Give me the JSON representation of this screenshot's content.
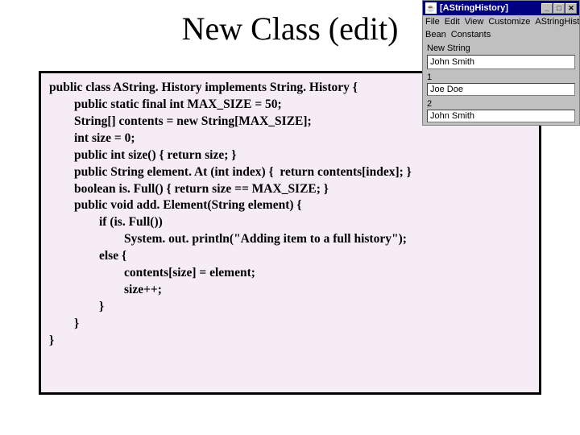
{
  "slide": {
    "title": "New Class (edit)"
  },
  "code": {
    "line1": "public class AString. History implements String. History {",
    "line2": "        public static final int MAX_SIZE = 50;",
    "line3": "        String[] contents = new String[MAX_SIZE];",
    "line4": "        int size = 0;",
    "line5": "        public int size() { return size; }",
    "line6": "        public String element. At (int index) {  return contents[index]; }",
    "line7": "        boolean is. Full() { return size == MAX_SIZE; }",
    "line8": "        public void add. Element(String element) {",
    "line9": "                if (is. Full())",
    "line10": "                        System. out. println(\"Adding item to a full history\");",
    "line11": "                else {",
    "line12": "                        contents[size] = element;",
    "line13": "                        size++;",
    "line14": "                }",
    "line15": "        }",
    "line16": "}"
  },
  "window": {
    "title": "[AStringHistory]",
    "minimize": "_",
    "maximize": "□",
    "close": "✕",
    "menus": {
      "file": "File",
      "edit": "Edit",
      "view": "View",
      "customize": "Customize",
      "ahistory": "AStringHistory"
    },
    "bean": "Bean",
    "constants": "Constants",
    "newStringLabel": "New String",
    "newStringValue": "John Smith",
    "index1": "1",
    "value1": "Joe Doe",
    "index2": "2",
    "value2": "John Smith"
  }
}
